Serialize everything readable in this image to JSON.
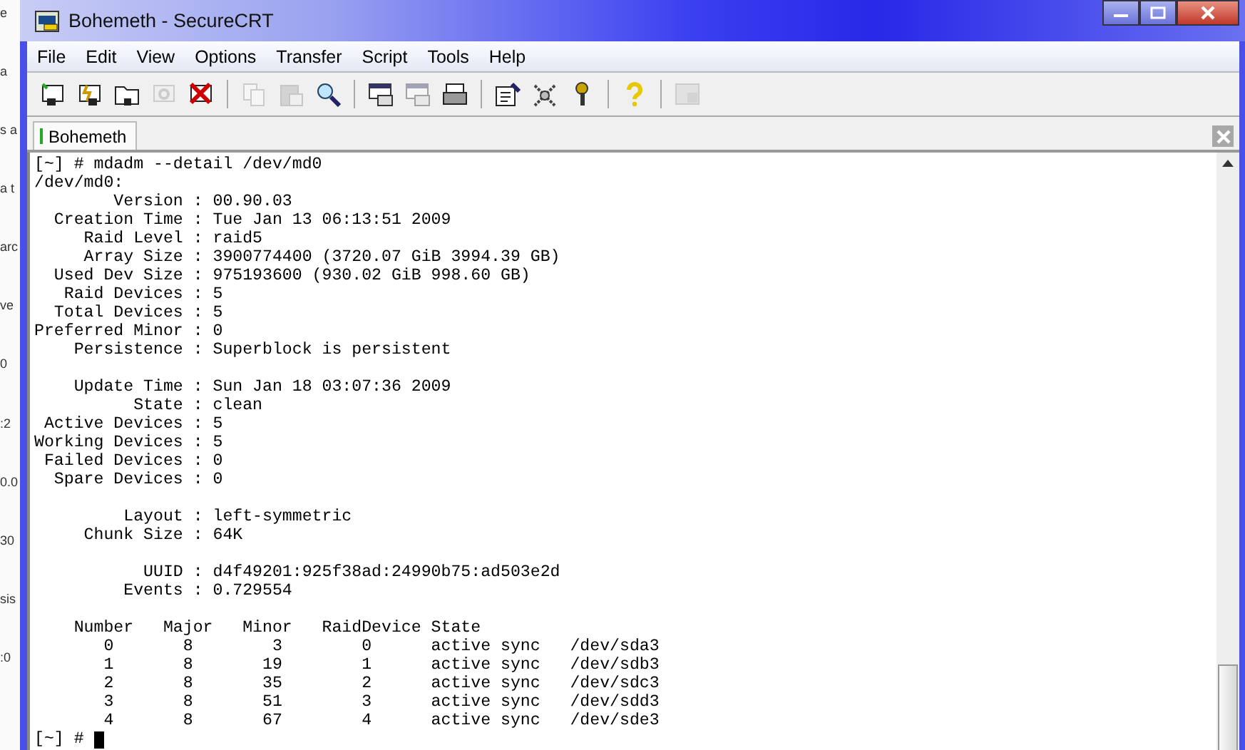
{
  "background_window": {
    "fragments": [
      "e",
      "a",
      "s a",
      "a t",
      "arc",
      "ve",
      "0",
      ":2",
      "0.0",
      "30",
      "sis",
      ":0"
    ]
  },
  "window": {
    "title": "Bohemeth - SecureCRT"
  },
  "menu": [
    "File",
    "Edit",
    "View",
    "Options",
    "Transfer",
    "Script",
    "Tools",
    "Help"
  ],
  "toolbar": [
    {
      "kind": "connect",
      "disabled": false
    },
    {
      "kind": "quick",
      "disabled": false
    },
    {
      "kind": "folder",
      "disabled": false
    },
    {
      "kind": "reconnect",
      "disabled": true
    },
    {
      "kind": "disconnect",
      "disabled": false
    },
    {
      "kind": "sep"
    },
    {
      "kind": "copy",
      "disabled": true
    },
    {
      "kind": "paste",
      "disabled": true
    },
    {
      "kind": "find",
      "disabled": false
    },
    {
      "kind": "sep"
    },
    {
      "kind": "log",
      "disabled": false
    },
    {
      "kind": "log",
      "disabled": true
    },
    {
      "kind": "print",
      "disabled": false
    },
    {
      "kind": "sep"
    },
    {
      "kind": "props",
      "disabled": false
    },
    {
      "kind": "keymap",
      "disabled": false
    },
    {
      "kind": "key",
      "disabled": false
    },
    {
      "kind": "sep"
    },
    {
      "kind": "help",
      "disabled": false
    },
    {
      "kind": "sep"
    },
    {
      "kind": "tile",
      "disabled": true
    }
  ],
  "tabs": [
    {
      "label": "Bohemeth",
      "selected": true,
      "connected": true
    }
  ],
  "terminal": {
    "blocks": [
      [
        "[~] # mdadm --detail /dev/md0",
        "/dev/md0:",
        "        Version : 00.90.03",
        "  Creation Time : Tue Jan 13 06:13:51 2009",
        "     Raid Level : raid5",
        "     Array Size : 3900774400 (3720.07 GiB 3994.39 GB)",
        "  Used Dev Size : 975193600 (930.02 GiB 998.60 GB)",
        "   Raid Devices : 5",
        "  Total Devices : 5",
        "Preferred Minor : 0",
        "    Persistence : Superblock is persistent"
      ],
      [
        "    Update Time : Sun Jan 18 03:07:36 2009",
        "          State : clean",
        " Active Devices : 5",
        "Working Devices : 5",
        " Failed Devices : 0",
        "  Spare Devices : 0"
      ],
      [
        "         Layout : left-symmetric",
        "     Chunk Size : 64K"
      ],
      [
        "           UUID : d4f49201:925f38ad:24990b75:ad503e2d",
        "         Events : 0.729554"
      ],
      [
        "    Number   Major   Minor   RaidDevice State",
        "       0       8        3        0      active sync   /dev/sda3",
        "       1       8       19        1      active sync   /dev/sdb3",
        "       2       8       35        2      active sync   /dev/sdc3",
        "       3       8       51        3      active sync   /dev/sdd3",
        "       4       8       67        4      active sync   /dev/sde3"
      ]
    ],
    "prompt": "[~] #"
  }
}
